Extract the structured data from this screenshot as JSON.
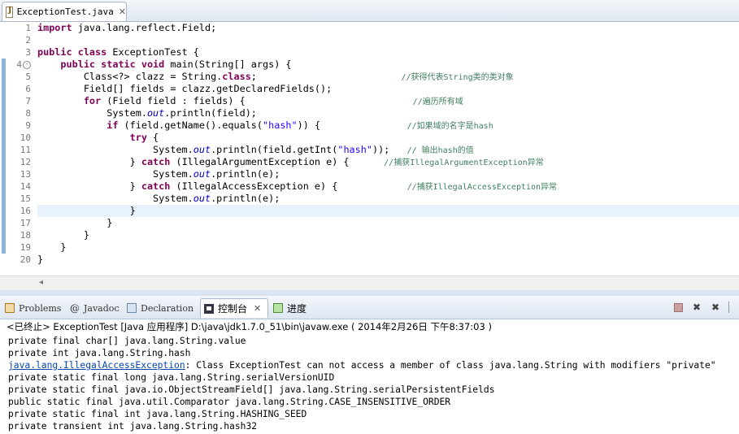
{
  "editor_tab": {
    "label": "ExceptionTest.java",
    "close": "✕"
  },
  "line_numbers": [
    "1",
    "2",
    "3",
    "4",
    "5",
    "6",
    "7",
    "8",
    "9",
    "10",
    "11",
    "12",
    "13",
    "14",
    "15",
    "16",
    "17",
    "18",
    "19",
    "20"
  ],
  "code": {
    "l1a": "import",
    "l1b": " java.lang.reflect.Field;",
    "l3a": "public class",
    "l3b": " ExceptionTest {",
    "l4a": "    ",
    "l4b": "public static void",
    "l4c": " main(String[] args) {",
    "l5a": "        Class<?> clazz = String.",
    "l5b": "class",
    "l5c": ";                         ",
    "l5d": "//获得代表String类的类对象",
    "l6": "        Field[] fields = clazz.getDeclaredFields();",
    "l7a": "        ",
    "l7b": "for",
    "l7c": " (Field field : fields) {                             ",
    "l7d": "//遍历所有域",
    "l8a": "            System.",
    "l8b": "out",
    "l8c": ".println(field);",
    "l9a": "            ",
    "l9b": "if",
    "l9c": " (field.getName().equals(",
    "l9d": "\"hash\"",
    "l9e": ")) {               ",
    "l9f": "//如果域的名字是hash",
    "l10a": "                ",
    "l10b": "try",
    "l10c": " {",
    "l11a": "                    System.",
    "l11b": "out",
    "l11c": ".println(field.getInt(",
    "l11d": "\"hash\"",
    "l11e": "));   ",
    "l11f": "// 输出hash的值",
    "l12a": "                } ",
    "l12b": "catch",
    "l12c": " (IllegalArgumentException e) {      ",
    "l12d": "//捕获IllegalArgumentException异常",
    "l13a": "                    System.",
    "l13b": "out",
    "l13c": ".println(e);",
    "l14a": "                } ",
    "l14b": "catch",
    "l14c": " (IllegalAccessException e) {            ",
    "l14d": "//捕获IllegalAccessException异常",
    "l15a": "                    System.",
    "l15b": "out",
    "l15c": ".println(e);",
    "l16": "                }",
    "l17": "            }",
    "l18": "        }",
    "l19": "    }",
    "l20": "}"
  },
  "view_tabs": {
    "problems": "Problems",
    "javadoc": "Javadoc",
    "declaration": "Declaration",
    "console": "控制台",
    "console_close": "✕",
    "progress": "进度"
  },
  "console": {
    "header": "<已终止> ExceptionTest [Java 应用程序] D:\\java\\jdk1.7.0_51\\bin\\javaw.exe ( 2014年2月26日 下午8:37:03 )",
    "lines": [
      "private final char[] java.lang.String.value",
      "private int java.lang.String.hash",
      "",
      "private static final long java.lang.String.serialVersionUID",
      "private static final java.io.ObjectStreamField[] java.lang.String.serialPersistentFields",
      "public static final java.util.Comparator java.lang.String.CASE_INSENSITIVE_ORDER",
      "private static final int java.lang.String.HASHING_SEED",
      "private transient int java.lang.String.hash32"
    ],
    "exception_link": "java.lang.IllegalAccessException",
    "exception_msg": ": Class ExceptionTest can not access a member of class java.lang.String with modifiers \"private\""
  },
  "colors": {
    "keyword": "#7f0055",
    "string": "#2a00ff",
    "comment": "#3f7f5f",
    "field": "#0000c0",
    "link": "#0645ad"
  },
  "icons": [
    "java-file-icon",
    "problems-icon",
    "javadoc-icon",
    "declaration-icon",
    "console-icon",
    "progress-icon",
    "terminate-icon",
    "remove-launch-icon",
    "remove-all-icon"
  ]
}
